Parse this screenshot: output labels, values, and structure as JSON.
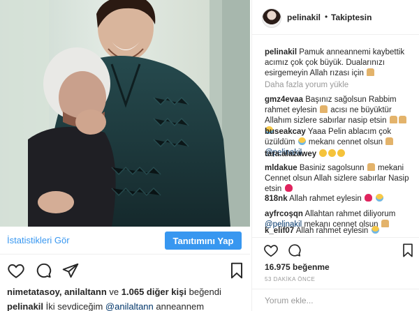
{
  "left_post": {
    "stats_link": "İstatistikleri Gör",
    "promote_button": "Tanıtımını Yap",
    "likes": {
      "users": "nimetatasoy, anilaltann",
      "middle": " ve ",
      "others": "1.065 diğer kişi",
      "suffix": " beğendi"
    },
    "caption": {
      "user": "pelinakil",
      "text_before": " İki sevdiceğim ",
      "mention": "@anilaltann",
      "text_after": " anneannem"
    },
    "icons": [
      "heart-icon",
      "comment-icon",
      "share-icon",
      "bookmark-icon"
    ]
  },
  "right_panel": {
    "header": {
      "username": "pelinakil",
      "separator": "•",
      "follow_status": "Takiptesin"
    },
    "caption": {
      "user": "pelinakil",
      "text": "Pamuk anneannemi kaybettik acımız çok çok büyük. Dualarınızı esirgemeyin Allah rızası için"
    },
    "load_more": "Daha fazla yorum yükle",
    "comments": [
      {
        "user": "gmz4evaa",
        "text_a": "Başınız sağolsun Rabbim rahmet eylesin",
        "text_b": "acısı ne büyüktür Allahım sizlere sabırlar nasip etsin"
      },
      {
        "user": "buseakcay",
        "text_a": "Yaaa Pelin ablacım çok üzüldüm",
        "text_b": "mekanı cennet olsun",
        "mention": "@pelinakil"
      },
      {
        "user": "tara.alazawey",
        "text_a": ""
      },
      {
        "user": "mldakue",
        "text_a": "Basiniz sagolsunn",
        "text_b": "mekani Cennet olsun Allah sizlere sabırlar Nasip etsin"
      },
      {
        "user": "818nk",
        "text_a": "Allah rahmet eylesin"
      },
      {
        "user": "ayfrcoşqn",
        "text_a": "Allahtan rahmet diliyorum",
        "mention": "@pelinakil",
        "text_b": "mekanı cennet olsun"
      },
      {
        "user": "k_elif07",
        "text_a": "Allah rahmet eylesin"
      }
    ],
    "likes_count": "16.975 beğenme",
    "timestamp": "53 DAKİKA ÖNCE",
    "comment_placeholder": "Yorum ekle...",
    "icons": [
      "heart-icon",
      "comment-icon",
      "bookmark-icon"
    ]
  },
  "colors": {
    "accent_blue": "#3897f0",
    "text": "#262626",
    "muted": "#999999",
    "mention": "#003569"
  }
}
